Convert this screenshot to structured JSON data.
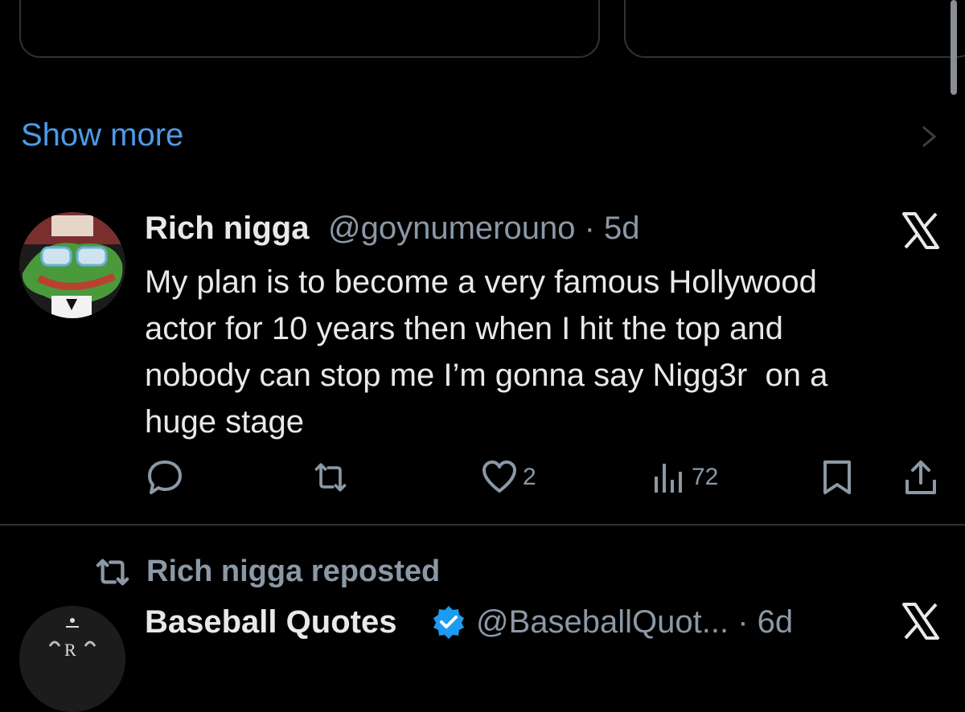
{
  "show_more": "Show more",
  "tweet": {
    "author_name": "Rich nigga",
    "handle_time": "@goynumerouno · 5d",
    "text_lines": [
      "My plan is to become a very famous Hollywood",
      "actor for 10 years then when I hit the top and",
      "nobody can stop me I’m gonna say Nigg3r  on a",
      "huge stage"
    ],
    "likes": "2",
    "views": "72"
  },
  "repost": {
    "label": "Rich nigga reposted",
    "author_name": "Baseball Quotes",
    "handle_time": "@BaseballQuot... · 6d"
  },
  "icons": {
    "reply": "reply-icon",
    "retweet": "retweet-icon",
    "like": "heart-icon",
    "views": "views-icon",
    "bookmark": "bookmark-icon",
    "share": "share-icon",
    "x_logo": "x-logo-icon",
    "verified": "verified-badge-icon",
    "chevron": "chevron-right-icon"
  },
  "colors": {
    "background": "#000000",
    "link": "#4c9bea",
    "secondary_text": "#8b98a5",
    "verified": "#1d9bf0",
    "divider": "#2f3336"
  }
}
